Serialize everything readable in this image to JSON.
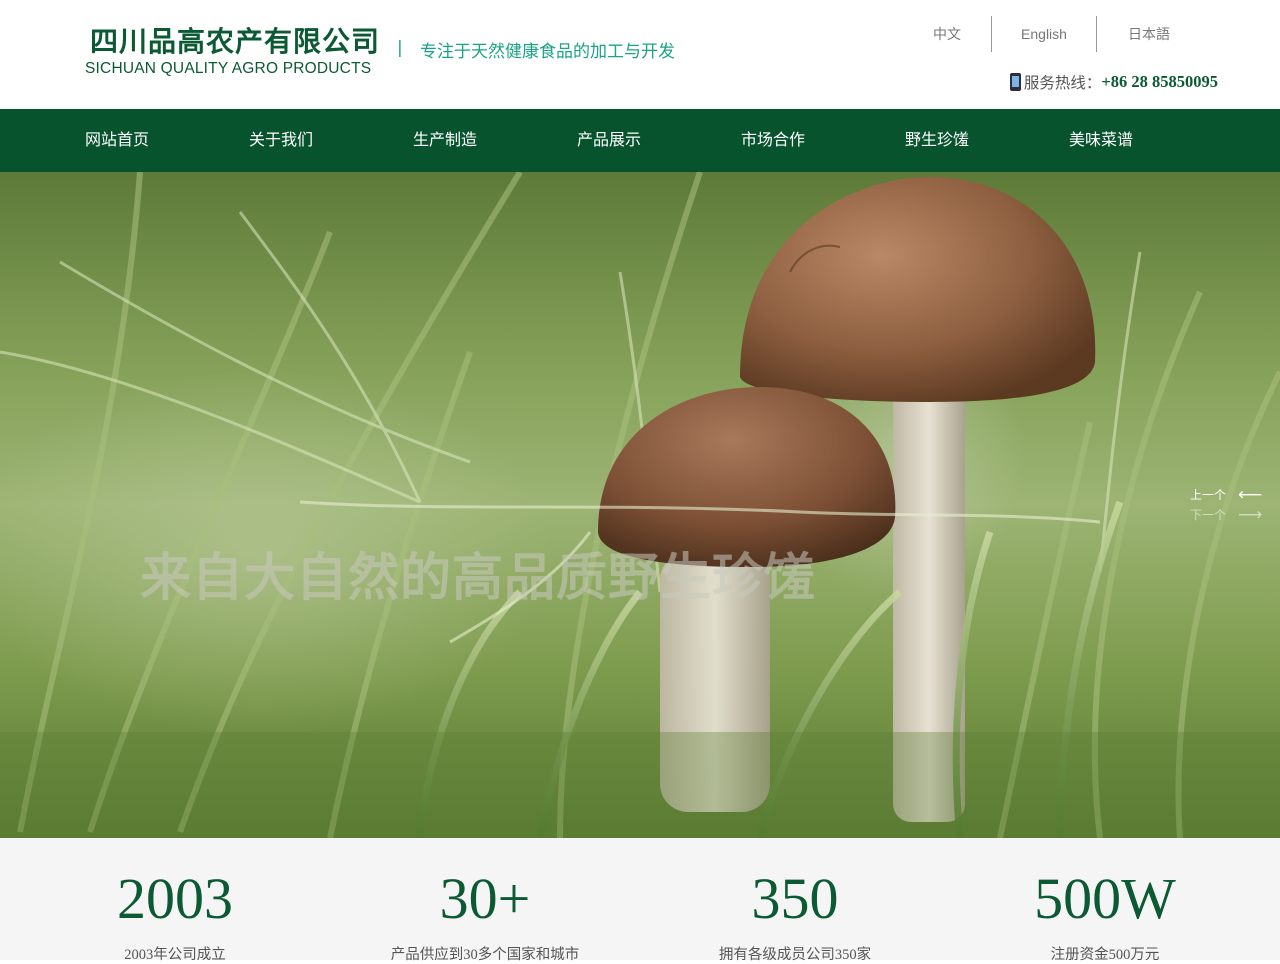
{
  "header": {
    "company_cn": "四川品高农产有限公司",
    "company_en": "SICHUAN QUALITY AGRO PRODUCTS",
    "slogan_separator": "|",
    "slogan": "专注于天然健康食品的加工与开发",
    "languages": [
      "中文",
      "English",
      "日本語"
    ],
    "hotline_label": "服务热线：",
    "hotline_number": "+86 28 85850095",
    "hotline_icon": "mobile-phone-icon"
  },
  "nav": {
    "items": [
      "网站首页",
      "关于我们",
      "生产制造",
      "产品展示",
      "市场合作",
      "野生珍馐",
      "美味菜谱"
    ]
  },
  "banner": {
    "caption": "来自大自然的高品质野生珍馐",
    "prev_label": "上一个",
    "next_label": "下一个",
    "prev_arrow": "⟵",
    "next_arrow": "⟶"
  },
  "stats": [
    {
      "value": "2003",
      "label": "2003年公司成立"
    },
    {
      "value": "30+",
      "label": "产品供应到30多个国家和城市"
    },
    {
      "value": "350",
      "label": "拥有各级成员公司350家"
    },
    {
      "value": "500W",
      "label": "注册资金500万元"
    }
  ],
  "colors": {
    "brand_green": "#07532e",
    "accent_teal": "#1aa487",
    "stats_bg": "#f5f5f5"
  }
}
